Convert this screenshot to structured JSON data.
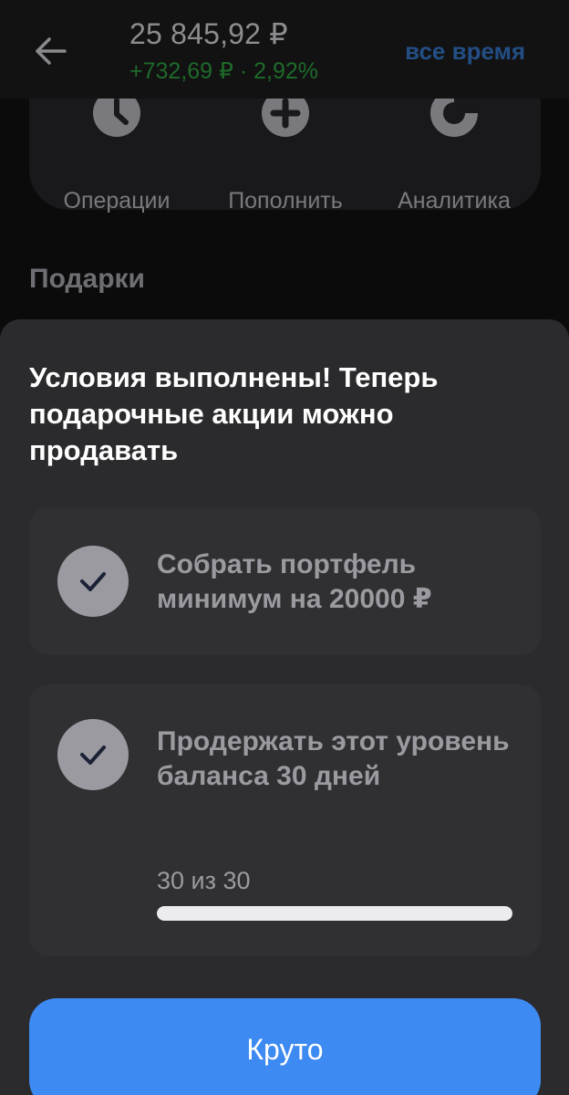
{
  "header": {
    "balance": "25 845,92 ₽",
    "change": "+732,69 ₽ · 2,92%",
    "period": "все время"
  },
  "actions": [
    {
      "label": "Операции",
      "icon": "clock-icon"
    },
    {
      "label": "Пополнить",
      "icon": "plus-circle-icon"
    },
    {
      "label": "Аналитика",
      "icon": "donut-chart-icon"
    }
  ],
  "section_title": "Подарки",
  "sheet": {
    "title": "Условия выполнены! Теперь подарочные акции можно продавать",
    "tasks": [
      {
        "text": "Собрать портфель минимум на 20000 ₽",
        "done": true
      },
      {
        "text": "Продержать этот уровень баланса 30 дней",
        "done": true,
        "progress_text": "30 из 30",
        "progress": 1.0
      }
    ],
    "button_label": "Круто"
  },
  "colors": {
    "accent": "#3d8bf2",
    "positive": "#1f6a2a",
    "period_link": "#234e84",
    "sheet_bg": "#2b2b2e",
    "card_bg": "#303033"
  }
}
